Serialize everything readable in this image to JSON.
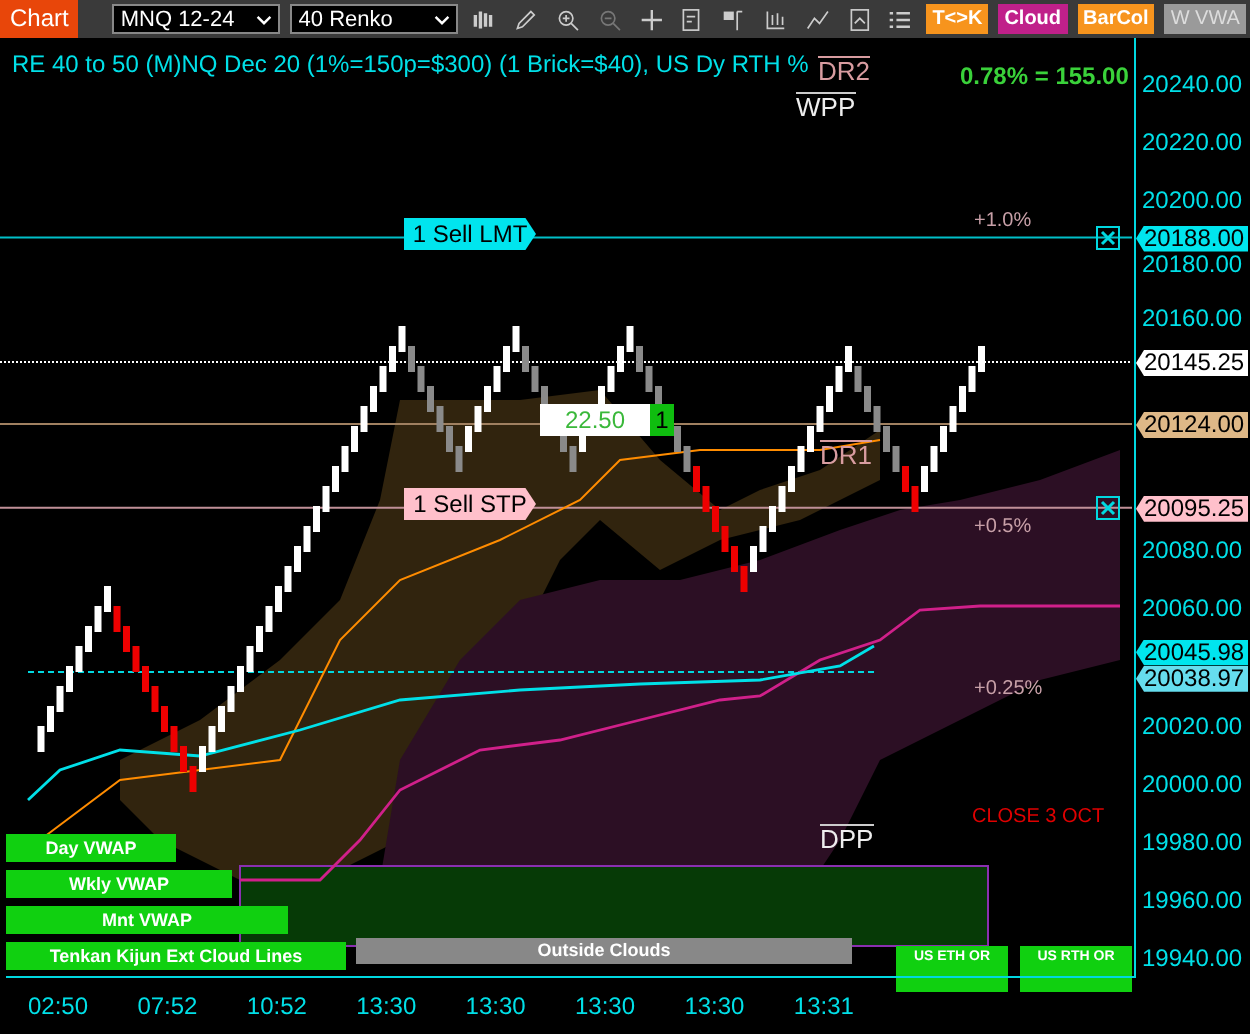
{
  "toolbar": {
    "title": "Chart",
    "symbol": "MNQ 12-24",
    "bar_type": "40 Renko",
    "buttons": [
      {
        "label": "T<>K",
        "color": "#f7941d",
        "disabled": false
      },
      {
        "label": "Cloud",
        "color": "#c0208a",
        "disabled": false
      },
      {
        "label": "BarCol",
        "color": "#f7941d",
        "disabled": false
      },
      {
        "label": "W VWA",
        "color": "#9a9a9a",
        "disabled": true
      }
    ]
  },
  "chart": {
    "header": "RE 40 to 50 (M)NQ Dec 20 (1%=150p=$300) (1 Brick=$40), US Dy RTH %",
    "stat": "0.78% = 155.00",
    "levels": [
      {
        "label": "DR2",
        "kind": "resistance"
      },
      {
        "label": "WPP",
        "kind": "pivot"
      },
      {
        "label": "DR1",
        "kind": "resistance"
      },
      {
        "label": "DPP",
        "kind": "pivot"
      }
    ],
    "percent_labels": [
      "+1.0%",
      "+0.5%",
      "+0.25%"
    ],
    "close_label": "CLOSE 3 OCT",
    "orders": [
      {
        "label": "1 Sell LMT",
        "color": "#00e5ee"
      },
      {
        "label": "1 Sell STP",
        "color": "#ffc0cb"
      }
    ],
    "position": {
      "value": "22.50",
      "quantity": "1"
    },
    "legend": [
      {
        "label": "Day VWAP"
      },
      {
        "label": "Wkly VWAP"
      },
      {
        "label": "Mnt VWAP"
      },
      {
        "label": "Tenkan Kijun Ext Cloud Lines"
      }
    ],
    "zone_label": "Outside Clouds",
    "range_buttons": [
      {
        "label": "US ETH OR"
      },
      {
        "label": "US RTH OR"
      }
    ],
    "price_axis": [
      {
        "label": "20240.00"
      },
      {
        "label": "20220.00"
      },
      {
        "label": "20200.00"
      },
      {
        "label": "20180.00"
      },
      {
        "label": "20160.00"
      },
      {
        "label": "20080.00"
      },
      {
        "label": "20060.00"
      },
      {
        "label": "20020.00"
      },
      {
        "label": "20000.00"
      },
      {
        "label": "19980.00"
      },
      {
        "label": "19960.00"
      },
      {
        "label": "19940.00"
      }
    ],
    "price_tags": [
      {
        "label": "20188.00",
        "color": "#00e5ee"
      },
      {
        "label": "20145.25",
        "color": "#ffffff"
      },
      {
        "label": "20124.00",
        "color": "#deb887"
      },
      {
        "label": "20095.25",
        "color": "#ffc0cb"
      },
      {
        "label": "20045.98",
        "color": "#00e5ee"
      },
      {
        "label": "20038.97",
        "color": "#66ddee"
      }
    ],
    "time_axis": [
      "02:50",
      "07:52",
      "10:52",
      "13:30",
      "13:30",
      "13:30",
      "13:30",
      "13:31"
    ]
  }
}
